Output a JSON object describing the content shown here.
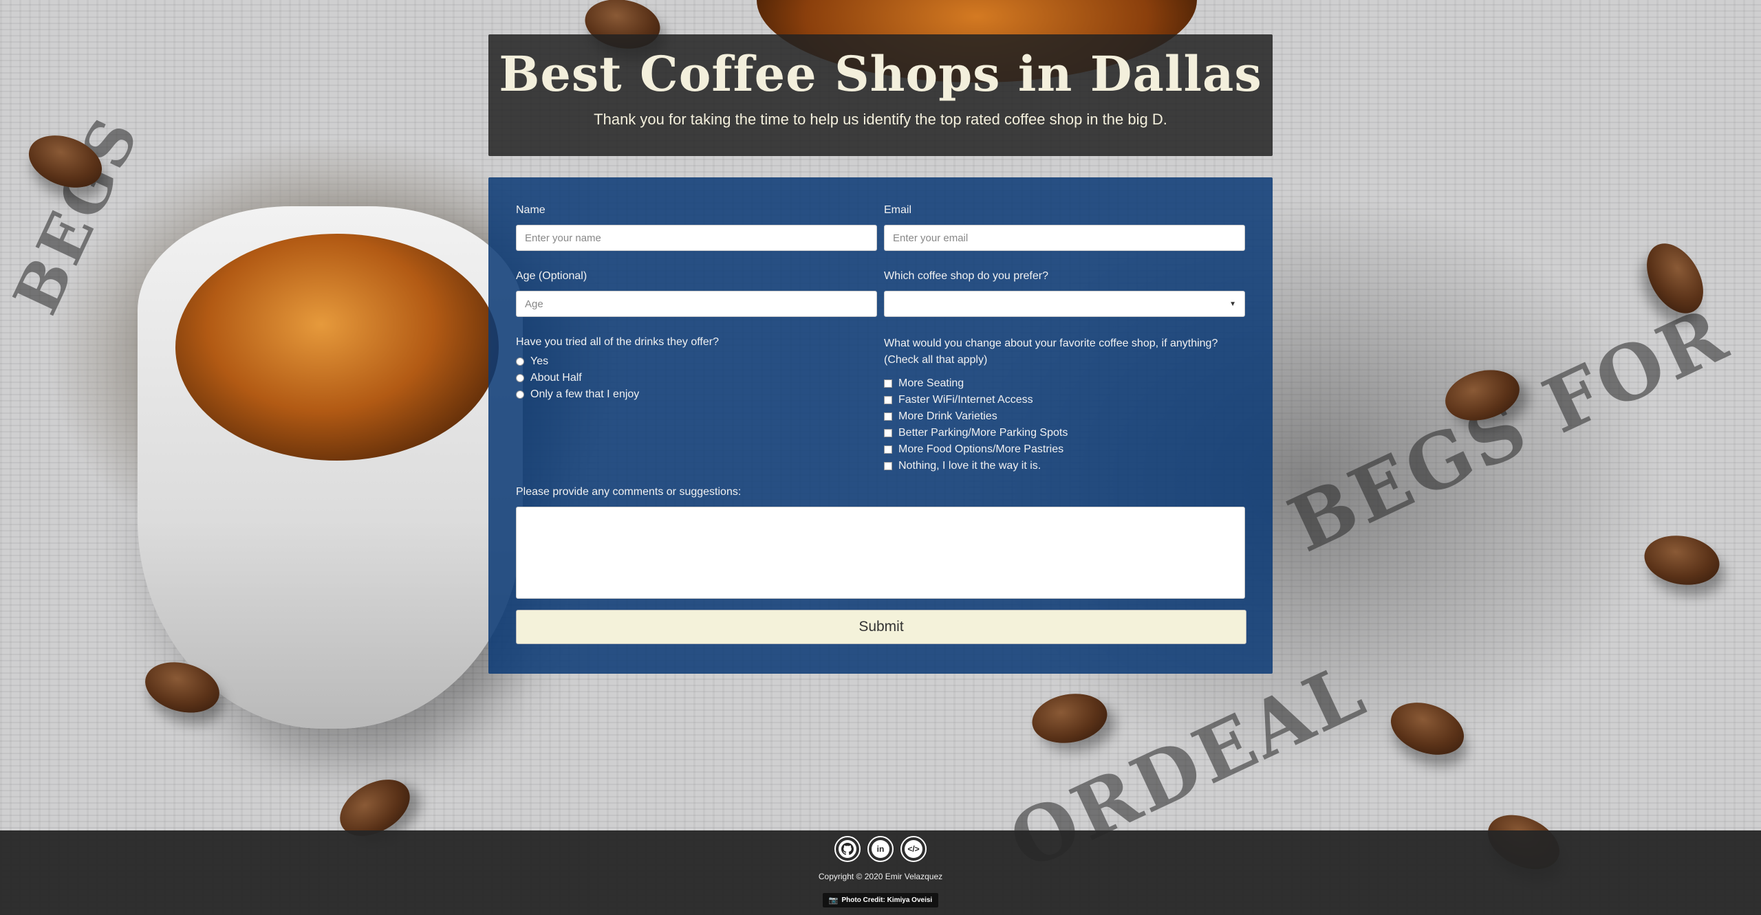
{
  "header": {
    "title": "Best Coffee Shops in Dallas",
    "subtitle": "Thank you for taking the time to help us identify the top rated coffee shop in the big D."
  },
  "form": {
    "name": {
      "label": "Name",
      "placeholder": "Enter your name"
    },
    "email": {
      "label": "Email",
      "placeholder": "Enter your email"
    },
    "age": {
      "label": "Age (Optional)",
      "placeholder": "Age"
    },
    "coffee_shop": {
      "label": "Which coffee shop do you prefer?",
      "selected": ""
    },
    "drinks_question": {
      "label": "Have you tried all of the drinks they offer?",
      "options": [
        "Yes",
        "About Half",
        "Only a few that I enjoy"
      ]
    },
    "change_question": {
      "label_line1": "What would you change about your favorite coffee shop, if anything?",
      "label_line2": "(Check all that apply)",
      "options": [
        "More Seating",
        "Faster WiFi/Internet Access",
        "More Drink Varieties",
        "Better Parking/More Parking Spots",
        "More Food Options/More Pastries",
        "Nothing, I love it the way it is."
      ]
    },
    "comments": {
      "label": "Please provide any comments or suggestions:"
    },
    "submit_label": "Submit"
  },
  "footer": {
    "social": [
      "github-icon",
      "linkedin-icon",
      "code-icon"
    ],
    "copyright": "Copyright © 2020 Emir Velazquez",
    "photo_credit": "Photo Credit: Kimiya Oveisi"
  },
  "colors": {
    "header_bg": "#222222",
    "form_bg": "#0c3a76",
    "title_color": "#f3efdc",
    "submit_bg": "#f4f2da",
    "footer_bg": "#262626"
  }
}
